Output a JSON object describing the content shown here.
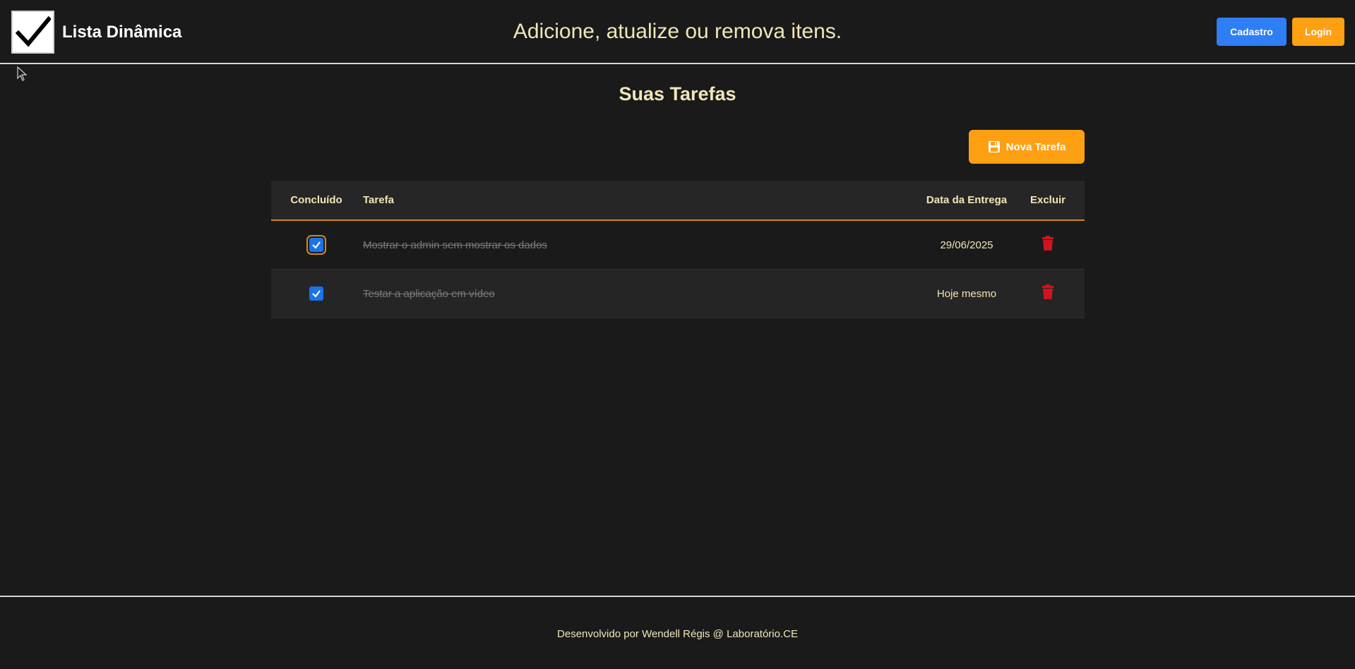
{
  "header": {
    "app_title": "Lista Dinâmica",
    "tagline": "Adicione, atualize ou remova itens.",
    "cadastro_label": "Cadastro",
    "login_label": "Login",
    "logo_icon": "checkmark-icon"
  },
  "main": {
    "title": "Suas Tarefas",
    "new_task_label": "Nova Tarefa",
    "new_task_icon": "floppy-disk-icon",
    "table": {
      "headers": {
        "done": "Concluído",
        "task": "Tarefa",
        "date": "Data da Entrega",
        "delete": "Excluir"
      },
      "rows": [
        {
          "done": true,
          "task": "Mostrar o admin sem mostrar os dados",
          "date": "29/06/2025"
        },
        {
          "done": true,
          "task": "Testar a aplicação em vídeo",
          "date": "Hoje mesmo"
        }
      ]
    }
  },
  "footer": {
    "text": "Desenvolvido por Wendell Régis @ Laboratório.CE"
  },
  "colors": {
    "background": "#1a1a1b",
    "accent_orange": "#ff9f12",
    "accent_blue": "#2f7ef5",
    "delete_red": "#d0141e",
    "text_cream": "#f1e6b8"
  }
}
